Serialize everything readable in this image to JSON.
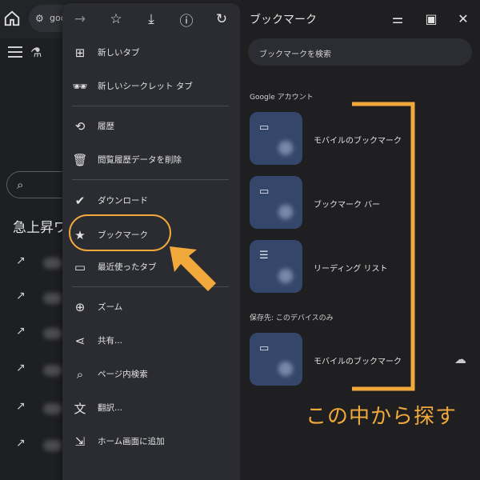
{
  "background_page": {
    "omnibox_text": "goo",
    "heading": "急上昇ワ"
  },
  "menu": {
    "icon_row": [
      {
        "name": "forward-icon",
        "glyph": "→"
      },
      {
        "name": "star-outline-icon",
        "glyph": "☆"
      },
      {
        "name": "download-icon",
        "glyph": "⤓"
      },
      {
        "name": "info-icon",
        "glyph": "ⓘ"
      },
      {
        "name": "reload-icon",
        "glyph": "↻"
      }
    ],
    "items": [
      {
        "label": "新しいタブ",
        "icon": "new-tab-icon"
      },
      {
        "label": "新しいシークレット タブ",
        "icon": "incognito-icon"
      },
      {
        "label": "履歴",
        "icon": "history-icon"
      },
      {
        "label": "閲覧履歴データを削除",
        "icon": "trash-icon"
      },
      {
        "label": "ダウンロード",
        "icon": "downloads-icon"
      },
      {
        "label": "ブックマーク",
        "icon": "star-icon"
      },
      {
        "label": "最近使ったタブ",
        "icon": "recent-tabs-icon"
      },
      {
        "label": "ズーム",
        "icon": "zoom-icon"
      },
      {
        "label": "共有...",
        "icon": "share-icon"
      },
      {
        "label": "ページ内検索",
        "icon": "find-in-page-icon"
      },
      {
        "label": "翻訳...",
        "icon": "translate-icon"
      },
      {
        "label": "ホーム画面に追加",
        "icon": "add-to-home-icon"
      }
    ]
  },
  "bookmarks": {
    "title": "ブックマーク",
    "search_placeholder": "ブックマークを検索",
    "section_account": "Google アカウント",
    "section_device": "保存先: このデバイスのみ",
    "account_items": [
      {
        "label": "モバイルのブックマーク",
        "icon": "folder-icon"
      },
      {
        "label": "ブックマーク バー",
        "icon": "folder-icon"
      },
      {
        "label": "リーディング リスト",
        "icon": "reading-list-icon"
      }
    ],
    "device_items": [
      {
        "label": "モバイルのブックマーク",
        "icon": "folder-icon"
      }
    ]
  },
  "annotation": {
    "text": "この中から探す",
    "color": "#f2a93b"
  },
  "colors": {
    "menu_bg": "#2b2c31",
    "page_bg": "#1f1f22",
    "thumb_bg": "#34476b",
    "accent": "#f2a93b"
  }
}
